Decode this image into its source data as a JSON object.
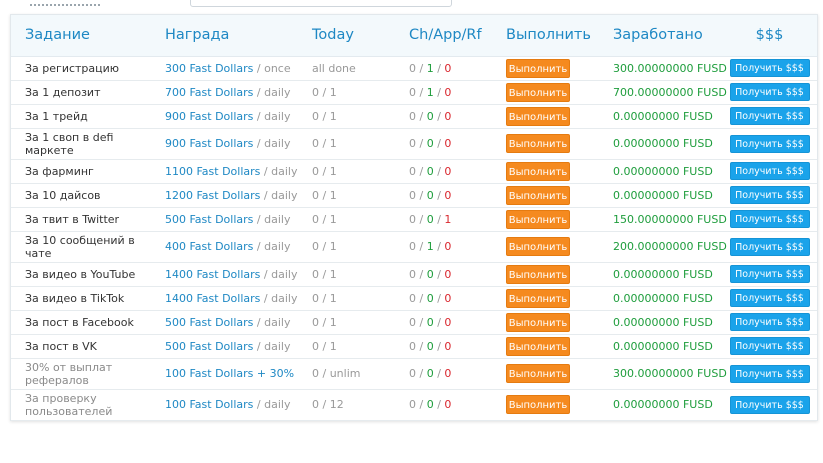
{
  "headers": {
    "task": "Задание",
    "reward": "Награда",
    "today": "Today",
    "stats": "Ch/App/Rf",
    "execute": "Выполнить",
    "earned": "Заработано",
    "payout": "$$$"
  },
  "buttons": {
    "execute_label": "Выполнить",
    "get_label": "Получить $$$"
  },
  "colors": {
    "header_text": "#1e88c4",
    "reward_amount": "#1e88c4",
    "earned": "#1e9d3c",
    "approved": "#1e9d3c",
    "rejected": "#d9272e",
    "execute_button": "#f58a1f",
    "get_button": "#1aa3ea"
  },
  "rows": [
    {
      "task": "За регистрацию",
      "reward_amount": "300 Fast Dollars",
      "reward_period": " / once",
      "today": "all done",
      "ch": "0",
      "app": "1",
      "rf": "0",
      "earned": "300.00000000 FUSD"
    },
    {
      "task": "За 1 депозит",
      "reward_amount": "700 Fast Dollars",
      "reward_period": " / daily",
      "today": "0 / 1",
      "ch": "0",
      "app": "1",
      "rf": "0",
      "earned": "700.00000000 FUSD"
    },
    {
      "task": "За 1 трейд",
      "reward_amount": "900 Fast Dollars",
      "reward_period": " / daily",
      "today": "0 / 1",
      "ch": "0",
      "app": "0",
      "rf": "0",
      "earned": "0.00000000 FUSD"
    },
    {
      "task": "За 1 своп в defi маркете",
      "reward_amount": "900 Fast Dollars",
      "reward_period": " / daily",
      "today": "0 / 1",
      "ch": "0",
      "app": "0",
      "rf": "0",
      "earned": "0.00000000 FUSD"
    },
    {
      "task": "За фарминг",
      "reward_amount": "1100 Fast Dollars",
      "reward_period": " / daily",
      "today": "0 / 1",
      "ch": "0",
      "app": "0",
      "rf": "0",
      "earned": "0.00000000 FUSD"
    },
    {
      "task": "За 10 дайсов",
      "reward_amount": "1200 Fast Dollars",
      "reward_period": " / daily",
      "today": "0 / 1",
      "ch": "0",
      "app": "0",
      "rf": "0",
      "earned": "0.00000000 FUSD"
    },
    {
      "task": "За твит в Twitter",
      "reward_amount": "500 Fast Dollars",
      "reward_period": " / daily",
      "today": "0 / 1",
      "ch": "0",
      "app": "0",
      "rf": "1",
      "earned": "150.00000000 FUSD"
    },
    {
      "task": "За 10 сообщений в чате",
      "reward_amount": "400 Fast Dollars",
      "reward_period": " / daily",
      "today": "0 / 1",
      "ch": "0",
      "app": "1",
      "rf": "0",
      "earned": "200.00000000 FUSD"
    },
    {
      "task": "За видео в YouTube",
      "reward_amount": "1400 Fast Dollars",
      "reward_period": " / daily",
      "today": "0 / 1",
      "ch": "0",
      "app": "0",
      "rf": "0",
      "earned": "0.00000000 FUSD"
    },
    {
      "task": "За видео в TikTok",
      "reward_amount": "1400 Fast Dollars",
      "reward_period": " / daily",
      "today": "0 / 1",
      "ch": "0",
      "app": "0",
      "rf": "0",
      "earned": "0.00000000 FUSD"
    },
    {
      "task": "За пост в Facebook",
      "reward_amount": "500 Fast Dollars",
      "reward_period": " / daily",
      "today": "0 / 1",
      "ch": "0",
      "app": "0",
      "rf": "0",
      "earned": "0.00000000 FUSD"
    },
    {
      "task": "За пост в VK",
      "reward_amount": "500 Fast Dollars",
      "reward_period": " / daily",
      "today": "0 / 1",
      "ch": "0",
      "app": "0",
      "rf": "0",
      "earned": "0.00000000 FUSD"
    },
    {
      "task": "30% от выплат рефералов",
      "reward_amount": "100 Fast Dollars + 30%",
      "reward_period": "",
      "today": "0 / unlim",
      "ch": "0",
      "app": "0",
      "rf": "0",
      "earned": "300.00000000 FUSD"
    },
    {
      "task": "За проверку пользователей",
      "reward_amount": "100 Fast Dollars",
      "reward_period": " / daily",
      "today": "0 / 12",
      "ch": "0",
      "app": "0",
      "rf": "0",
      "earned": "0.00000000 FUSD"
    }
  ]
}
